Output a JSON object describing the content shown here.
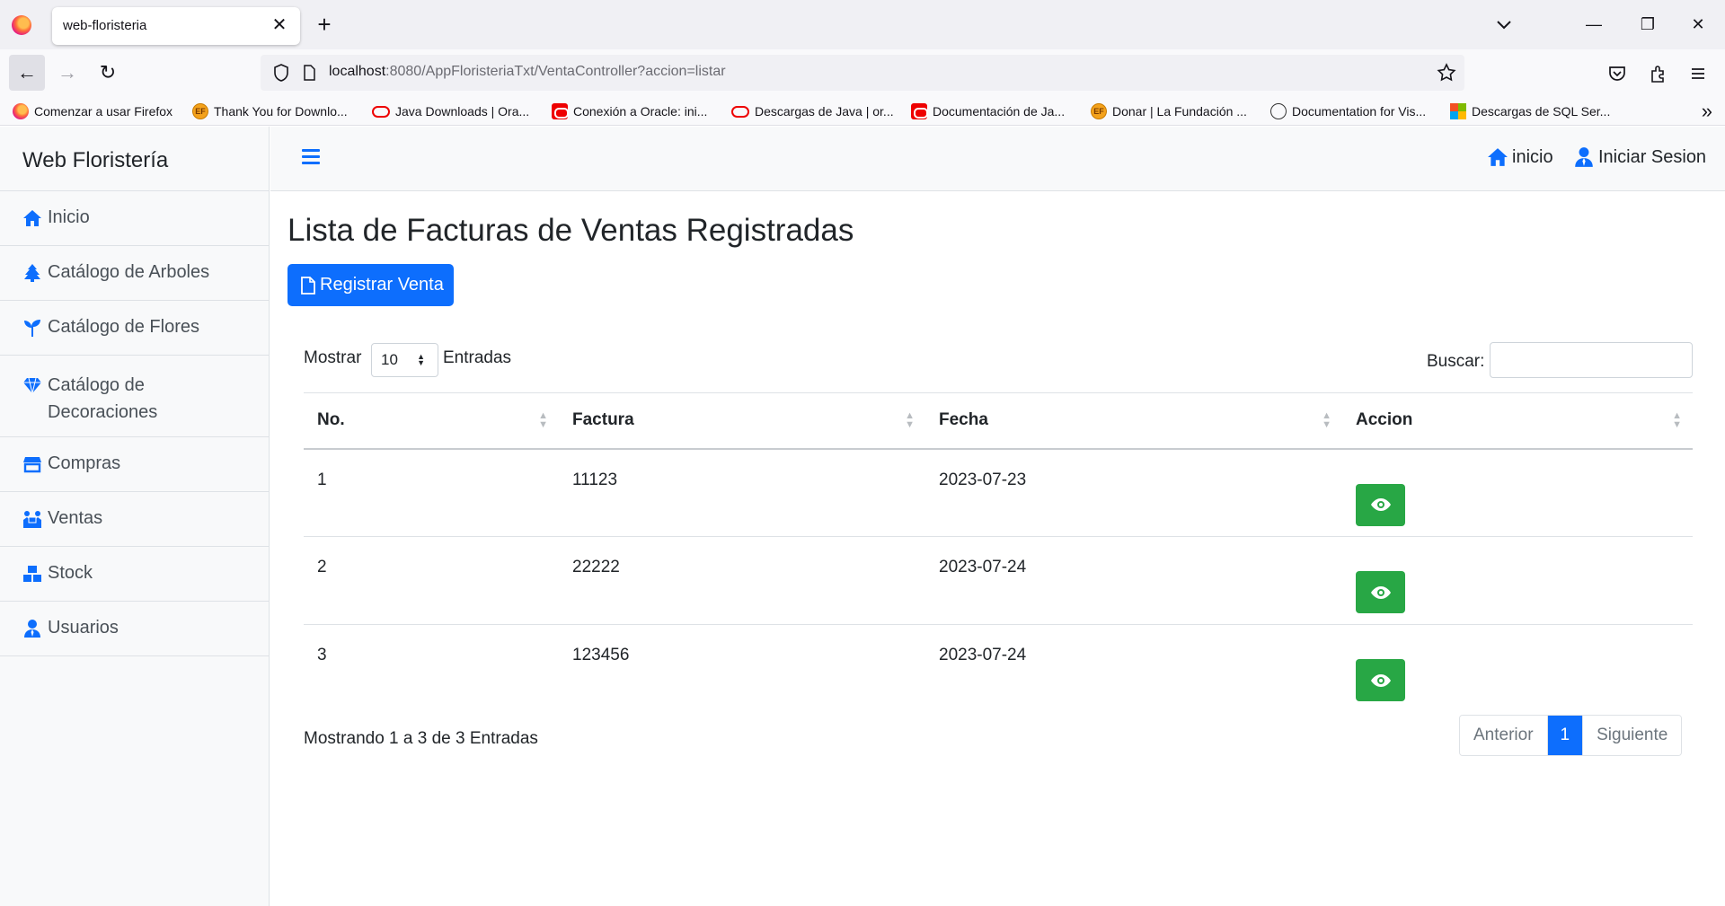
{
  "browser": {
    "tab_title": "web-floristeria",
    "url_host": "localhost",
    "url_rest": ":8080/AppFloristeriaTxt/VentaController?accion=listar",
    "bookmarks": [
      {
        "label": "Comenzar a usar Firefox",
        "icon": "firefox-icon"
      },
      {
        "label": "Thank You for Downlo...",
        "icon": "ef-icon"
      },
      {
        "label": "Java Downloads | Ora...",
        "icon": "oracle-icon"
      },
      {
        "label": "Conexión a Oracle: ini...",
        "icon": "oracle-red-icon"
      },
      {
        "label": "Descargas de Java | or...",
        "icon": "oracle-icon"
      },
      {
        "label": "Documentación de Ja...",
        "icon": "oracle-red-icon"
      },
      {
        "label": "Donar | La Fundación ...",
        "icon": "ef-icon"
      },
      {
        "label": "Documentation for Vis...",
        "icon": "globe-icon"
      },
      {
        "label": "Descargas de SQL Ser...",
        "icon": "microsoft-icon"
      }
    ],
    "ef_badge": "EF"
  },
  "sidebar": {
    "brand": "Web Floristería",
    "items": [
      {
        "label": "Inicio",
        "icon": "home-icon"
      },
      {
        "label": "Catálogo de Arboles",
        "icon": "tree-icon"
      },
      {
        "label": "Catálogo de Flores",
        "icon": "seedling-icon"
      },
      {
        "label": "Catálogo de Decoraciones",
        "icon": "gem-icon"
      },
      {
        "label": "Compras",
        "icon": "store-icon"
      },
      {
        "label": "Ventas",
        "icon": "people-carry-icon"
      },
      {
        "label": "Stock",
        "icon": "boxes-icon"
      },
      {
        "label": "Usuarios",
        "icon": "user-tie-icon"
      }
    ]
  },
  "topbar": {
    "home_label": "inicio",
    "login_label": "Iniciar Sesion"
  },
  "main": {
    "title": "Lista de Facturas de Ventas Registradas",
    "register_button": "Registrar Venta",
    "length_before": "Mostrar",
    "length_value": "10",
    "length_after": "Entradas",
    "search_label": "Buscar:",
    "search_value": "",
    "columns": [
      "No.",
      "Factura",
      "Fecha",
      "Accion"
    ],
    "rows": [
      {
        "no": "1",
        "factura": "11123",
        "fecha": "2023-07-23"
      },
      {
        "no": "2",
        "factura": "22222",
        "fecha": "2023-07-24"
      },
      {
        "no": "3",
        "factura": "123456",
        "fecha": "2023-07-24"
      }
    ],
    "info": "Mostrando 1 a 3 de 3 Entradas",
    "pagination": {
      "prev": "Anterior",
      "current": "1",
      "next": "Siguiente"
    }
  },
  "colors": {
    "primary": "#0d6efd",
    "success": "#28a745",
    "sidebar_bg": "#f8f9fa"
  }
}
